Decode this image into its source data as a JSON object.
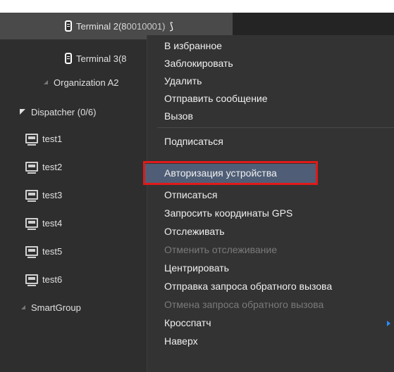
{
  "tree": {
    "items": [
      {
        "label": "Terminal 2(8",
        "extra": "0010001)",
        "icon": "phone-icon"
      },
      {
        "label": "Terminal 3(8",
        "icon": "phone-icon"
      },
      {
        "label": "Organization A2",
        "icon": "collapsed-triangle-icon"
      },
      {
        "label": "Dispatcher (0/6)",
        "icon": "expanded-triangle-icon"
      },
      {
        "label": "test1",
        "icon": "pc-icon"
      },
      {
        "label": "test2",
        "icon": "pc-icon"
      },
      {
        "label": "test3",
        "icon": "pc-icon"
      },
      {
        "label": "test4",
        "icon": "pc-icon"
      },
      {
        "label": "test5",
        "icon": "pc-icon"
      },
      {
        "label": "test6",
        "icon": "pc-icon"
      },
      {
        "label": "SmartGroup",
        "icon": "collapsed-triangle-icon"
      }
    ]
  },
  "menu": {
    "items": [
      {
        "label": "В избранное",
        "disabled": false
      },
      {
        "label": "Заблокировать",
        "disabled": false
      },
      {
        "label": "Удалить",
        "disabled": false
      },
      {
        "label": "Отправить сообщение",
        "disabled": false
      },
      {
        "label": "Вызов",
        "disabled": false
      },
      {
        "label": "Подписаться",
        "disabled": false
      },
      {
        "label": "Авторизация устройства",
        "disabled": false,
        "highlighted": true
      },
      {
        "label": "Отписаться",
        "disabled": false
      },
      {
        "label": "Запросить координаты GPS",
        "disabled": false
      },
      {
        "label": "Отслеживать",
        "disabled": false
      },
      {
        "label": "Отменить отслеживание",
        "disabled": true
      },
      {
        "label": "Центрировать",
        "disabled": false
      },
      {
        "label": "Отправка запроса обратного вызова",
        "disabled": false
      },
      {
        "label": "Отмена запроса обратного вызова",
        "disabled": true
      },
      {
        "label": "Кросспатч",
        "disabled": false,
        "submenu": true
      },
      {
        "label": "Наверх",
        "disabled": false
      }
    ]
  },
  "colors": {
    "highlight": "#4f5e76",
    "annotation_box": "#e01919",
    "submenu_arrow": "#2b8cff"
  }
}
